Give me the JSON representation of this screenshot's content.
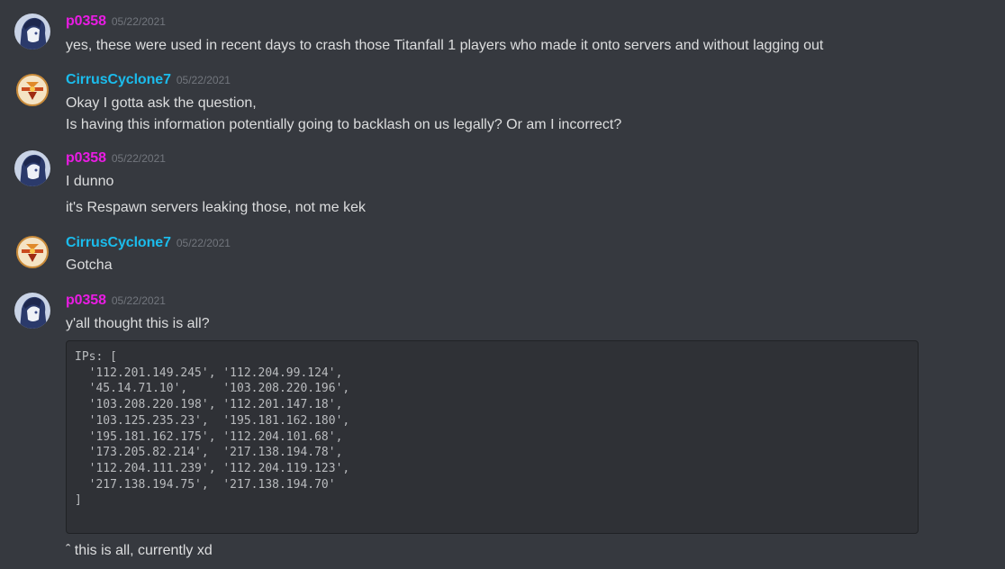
{
  "colors": {
    "p0358": "#e91ce3",
    "cirrus": "#1bbcec",
    "background": "#36393f",
    "timestamp": "#72767d"
  },
  "messages": [
    {
      "username": "p0358",
      "timestamp": "05/22/2021",
      "lines": [
        "yes, these were used in recent days to crash those Titanfall 1 players who made it onto servers and without lagging out"
      ]
    },
    {
      "username": "CirrusCyclone7",
      "timestamp": "05/22/2021",
      "lines": [
        "Okay I gotta ask the question,",
        "Is having this information potentially going to backlash on us legally? Or am I incorrect?"
      ]
    },
    {
      "username": "p0358",
      "timestamp": "05/22/2021",
      "lines": [
        "I dunno",
        "it's Respawn servers leaking those, not me kek"
      ]
    },
    {
      "username": "CirrusCyclone7",
      "timestamp": "05/22/2021",
      "lines": [
        "Gotcha"
      ]
    },
    {
      "username": "p0358",
      "timestamp": "05/22/2021",
      "lines": [
        "y'all thought this is all?",
        "ˆ this is all, currently xd"
      ]
    }
  ],
  "code_block": "IPs: [\n  '112.201.149.245', '112.204.99.124',\n  '45.14.71.10',     '103.208.220.196',\n  '103.208.220.198', '112.201.147.18',\n  '103.125.235.23',  '195.181.162.180',\n  '195.181.162.175', '112.204.101.68',\n  '173.205.82.214',  '217.138.194.78',\n  '112.204.111.239', '112.204.119.123',\n  '217.138.194.75',  '217.138.194.70'\n]",
  "icons": {
    "p0358_avatar": "anime-character-avatar",
    "cirrus_avatar": "emblem-logo-avatar"
  }
}
